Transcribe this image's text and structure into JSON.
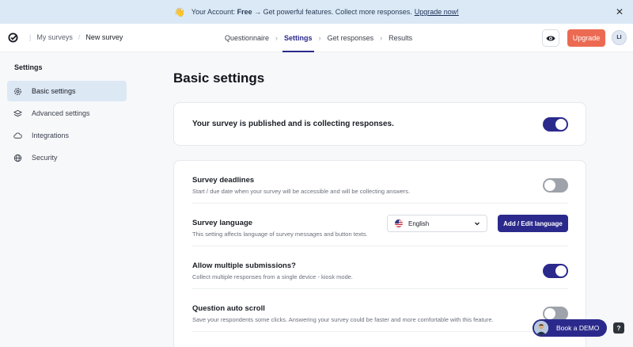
{
  "banner": {
    "hand_icon": "👋",
    "prefix": "Your Account:",
    "plan": "Free",
    "message": "→ Get powerful features. Collect more responses.",
    "link": "Upgrade now!",
    "close_icon": "✕"
  },
  "nav": {
    "breadcrumbs": [
      "My surveys",
      "New survey"
    ],
    "tabs": [
      "Questionnaire",
      "Settings",
      "Get responses",
      "Results"
    ],
    "active_tab": "Settings",
    "upgrade_label": "Upgrade",
    "avatar_initials": "LI"
  },
  "sidebar": {
    "title": "Settings",
    "items": [
      {
        "label": "Basic settings",
        "icon": "gear-icon",
        "active": true
      },
      {
        "label": "Advanced settings",
        "icon": "layers-icon",
        "active": false
      },
      {
        "label": "Integrations",
        "icon": "cloud-icon",
        "active": false
      },
      {
        "label": "Security",
        "icon": "globe-icon",
        "active": false
      }
    ]
  },
  "main": {
    "title": "Basic settings",
    "published": {
      "text": "Your survey is published and is collecting responses.",
      "enabled": true
    },
    "settings": [
      {
        "title": "Survey deadlines",
        "desc": "Start / due date when your survey will be accessible and will be collecting answers.",
        "enabled": false
      },
      {
        "title": "Survey language",
        "desc": "This setting affects language of survey messages and button texts.",
        "language": "English",
        "button": "Add / Edit language"
      },
      {
        "title": "Allow multiple submissions?",
        "desc": "Collect multiple responses from a single device - kiosk mode.",
        "enabled": true
      },
      {
        "title": "Question auto scroll",
        "desc": "Save your respondents some clicks. Answering your survey could be faster and more comfortable with this feature.",
        "enabled": false
      }
    ]
  },
  "footer": {
    "demo_label": "Book a DEMO",
    "help_label": "?"
  },
  "colors": {
    "accent": "#2b2a8c",
    "upgrade": "#ec6a52",
    "banner_bg": "#dbe9f6",
    "active_side": "#dce8f4"
  }
}
